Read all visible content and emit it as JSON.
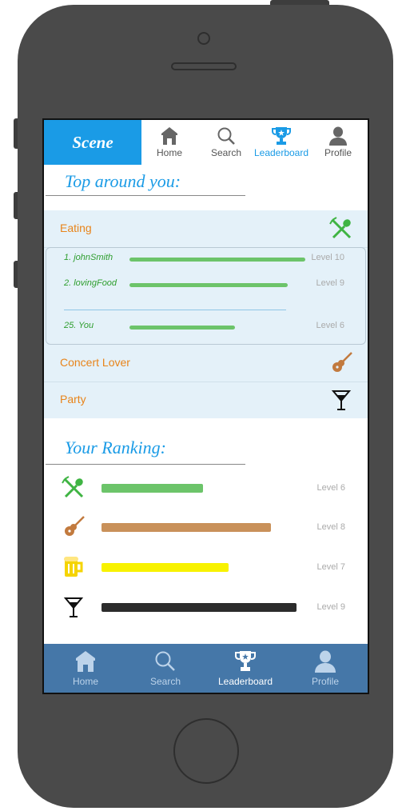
{
  "app": {
    "brand": "Scene"
  },
  "top_nav": [
    {
      "label": "Home",
      "icon": "home-icon",
      "active": false
    },
    {
      "label": "Search",
      "icon": "search-icon",
      "active": false
    },
    {
      "label": "Leaderboard",
      "icon": "trophy-icon",
      "active": true
    },
    {
      "label": "Profile",
      "icon": "profile-icon",
      "active": false
    }
  ],
  "top_around": {
    "title": "Top around you:",
    "categories": [
      {
        "label": "Eating",
        "icon": "fork-spoon-icon"
      },
      {
        "label": "Concert Lover",
        "icon": "guitar-icon"
      },
      {
        "label": "Party",
        "icon": "cocktail-icon"
      }
    ],
    "leaders": [
      {
        "name": "1. johnSmith",
        "level": "Level 10",
        "progress": 1.0
      },
      {
        "name": "2. lovingFood",
        "level": "Level 9",
        "progress": 0.9
      },
      {
        "name": "25. You",
        "level": "Level 6",
        "progress": 0.6
      }
    ]
  },
  "ranking": {
    "title": "Your Ranking:",
    "rows": [
      {
        "icon": "fork-spoon-icon",
        "level": "Level 6",
        "progress": 0.52,
        "color": "#6cc46a"
      },
      {
        "icon": "guitar-icon",
        "level": "Level 8",
        "progress": 0.87,
        "color": "#c9915a"
      },
      {
        "icon": "beer-icon",
        "level": "Level 7",
        "progress": 0.65,
        "color": "#f8f200"
      },
      {
        "icon": "cocktail-icon",
        "level": "Level 9",
        "progress": 1.0,
        "color": "#2c2c2c"
      }
    ]
  },
  "bottom_nav": [
    {
      "label": "Home",
      "icon": "home-icon",
      "active": false
    },
    {
      "label": "Search",
      "icon": "search-icon",
      "active": false
    },
    {
      "label": "Leaderboard",
      "icon": "trophy-icon",
      "active": true
    },
    {
      "label": "Profile",
      "icon": "profile-icon",
      "active": false
    }
  ],
  "colors": {
    "accent": "#1a9be6",
    "orange": "#e8841a",
    "bottom_bar": "#4577a8"
  }
}
